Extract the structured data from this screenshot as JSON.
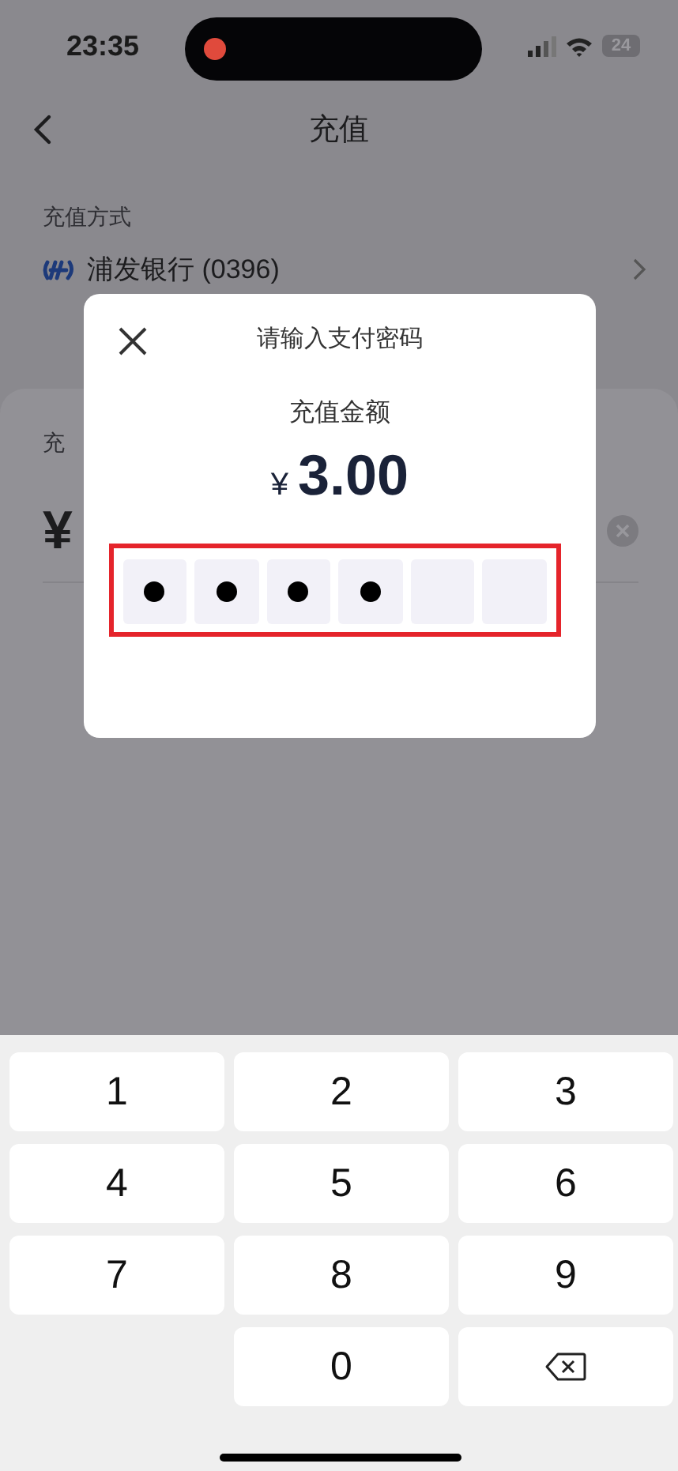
{
  "status_bar": {
    "time": "23:35",
    "battery": "24",
    "recording": true
  },
  "nav": {
    "title": "充值"
  },
  "payment_method": {
    "label": "充值方式",
    "bank": "浦发银行 (0396)"
  },
  "amount_sheet": {
    "label": "充",
    "currency": "¥"
  },
  "dialog": {
    "title": "请输入支付密码",
    "amount_label": "充值金额",
    "currency": "¥",
    "amount": "3.00",
    "pin": [
      {
        "filled": true
      },
      {
        "filled": true
      },
      {
        "filled": true
      },
      {
        "filled": true
      },
      {
        "filled": false
      },
      {
        "filled": false
      }
    ]
  },
  "keypad": [
    {
      "kind": "digit",
      "label": "1"
    },
    {
      "kind": "digit",
      "label": "2"
    },
    {
      "kind": "digit",
      "label": "3"
    },
    {
      "kind": "digit",
      "label": "4"
    },
    {
      "kind": "digit",
      "label": "5"
    },
    {
      "kind": "digit",
      "label": "6"
    },
    {
      "kind": "digit",
      "label": "7"
    },
    {
      "kind": "digit",
      "label": "8"
    },
    {
      "kind": "digit",
      "label": "9"
    },
    {
      "kind": "blank"
    },
    {
      "kind": "digit",
      "label": "0"
    },
    {
      "kind": "delete"
    }
  ]
}
